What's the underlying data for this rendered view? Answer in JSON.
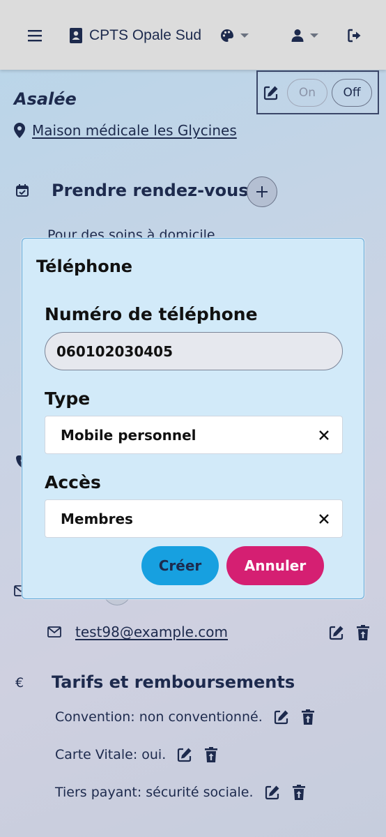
{
  "header": {
    "brand": "CPTS Opale Sud",
    "icons": [
      "menu-icon",
      "contact-card-icon",
      "palette-icon",
      "user-icon",
      "logout-icon"
    ]
  },
  "page": {
    "title": "Asalée",
    "location": "Maison médicale les Glycines",
    "edit_toggle": {
      "on_label": "On",
      "off_label": "Off",
      "selected": "Off"
    },
    "sections": {
      "appointment": {
        "heading": "Prendre rendez-vous",
        "note": "Pour des soins à domicile"
      },
      "email": {
        "address": "test98@example.com"
      },
      "tarifs": {
        "heading": "Tarifs et remboursements",
        "items": [
          "Convention: non conventionné.",
          "Carte Vitale: oui.",
          "Tiers payant: sécurité sociale."
        ]
      }
    }
  },
  "modal": {
    "title": "Téléphone",
    "phone_label": "Numéro de téléphone",
    "phone_value": "060102030405",
    "type_label": "Type",
    "type_value": "Mobile personnel",
    "access_label": "Accès",
    "access_value": "Membres",
    "create_label": "Créer",
    "cancel_label": "Annuler"
  },
  "colors": {
    "primary_text": "#1d2a4d",
    "create_button": "#17a0e0",
    "cancel_button": "#d51f72",
    "modal_bg": "#d2eaf9",
    "topbar_bg": "#dcdcdc"
  }
}
